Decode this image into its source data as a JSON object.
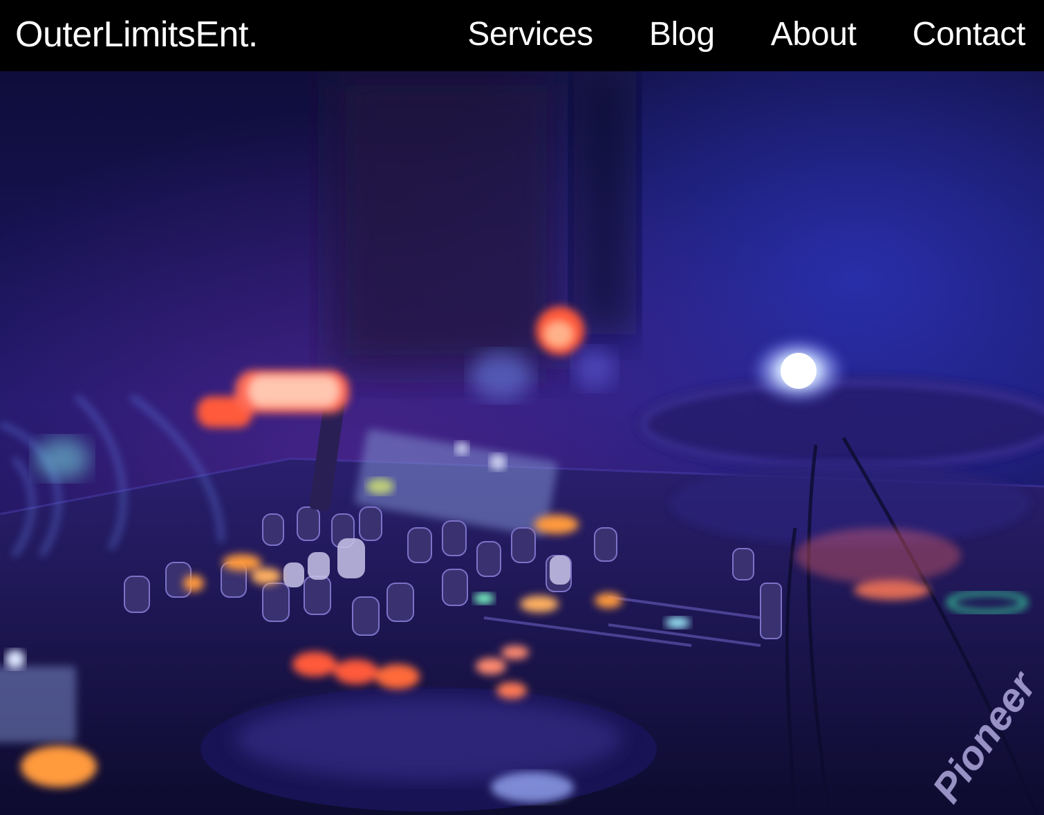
{
  "header": {
    "brand": "OuterLimitsEnt.",
    "nav": [
      {
        "label": "Services"
      },
      {
        "label": "Blog"
      },
      {
        "label": "About"
      },
      {
        "label": "Contact"
      }
    ]
  },
  "hero": {
    "image": "dj-mixer-photo",
    "mixer_brand": "Pioneer"
  },
  "colors": {
    "nav_background": "#000000",
    "nav_text": "#ffffff",
    "hero_tone": "#1a1760",
    "light_orange": "#ff9a3c",
    "light_red": "#ff3b2f"
  }
}
